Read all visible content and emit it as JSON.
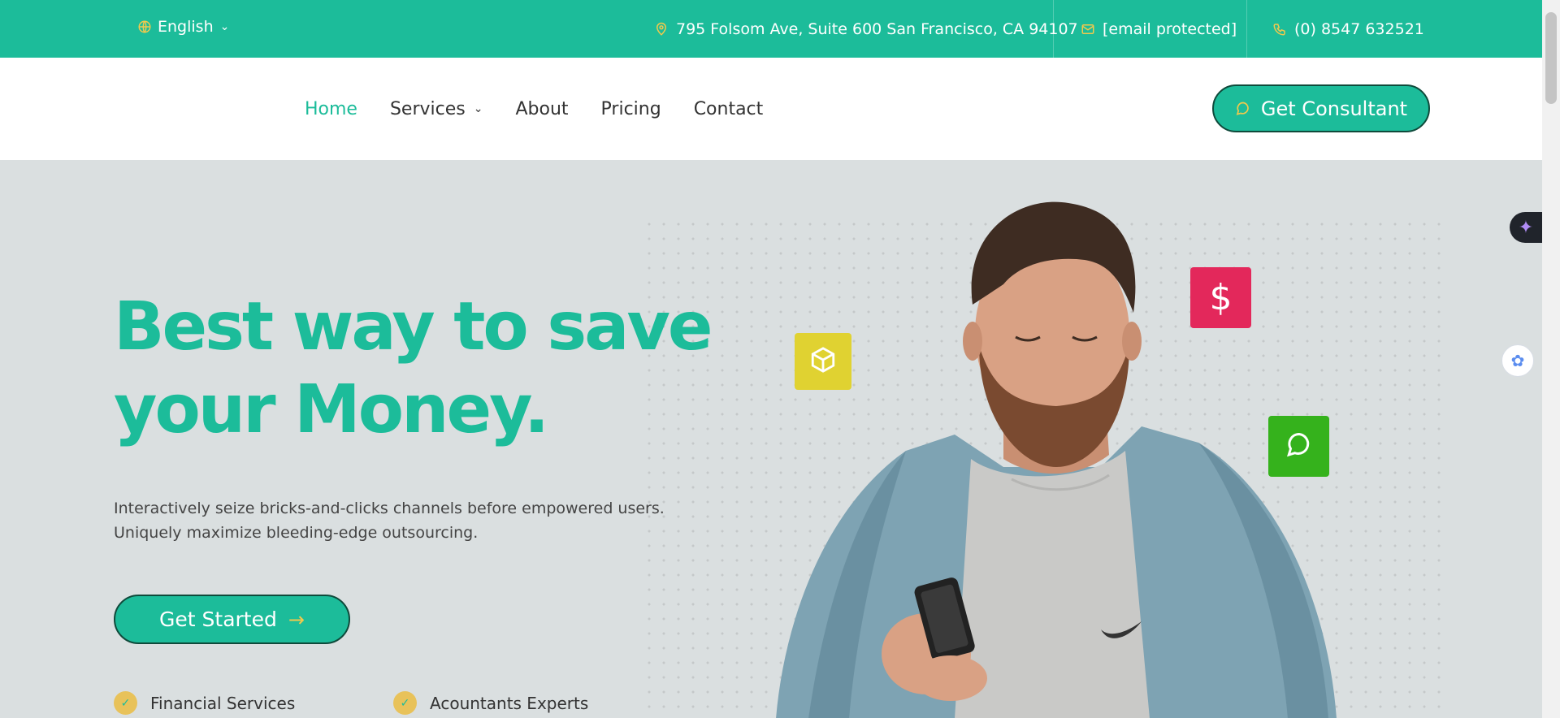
{
  "topbar": {
    "language": "English",
    "address": "795 Folsom Ave, Suite 600 San Francisco, CA 94107",
    "email": "[email protected]",
    "phone": "(0) 8547 632521"
  },
  "nav": {
    "items": [
      {
        "label": "Home",
        "active": true
      },
      {
        "label": "Services",
        "has_dropdown": true
      },
      {
        "label": "About"
      },
      {
        "label": "Pricing"
      },
      {
        "label": "Contact"
      }
    ],
    "cta_label": "Get Consultant"
  },
  "hero": {
    "headline_line1": "Best way to save",
    "headline_line2": "your Money.",
    "sub_line1": "Interactively seize bricks-and-clicks channels before empowered users.",
    "sub_line2": "Uniquely maximize bleeding-edge outsourcing.",
    "button_label": "Get Started",
    "features": [
      "Financial Services",
      "Acountants Experts"
    ],
    "tiles": [
      {
        "icon": "cube-icon",
        "color": "#e0d231"
      },
      {
        "icon": "dollar-icon",
        "color": "#e3285b",
        "glyph": "$"
      },
      {
        "icon": "chat-icon",
        "color": "#35b21c"
      }
    ]
  },
  "colors": {
    "brand": "#1cbc9a",
    "accent": "#f2c94c",
    "hero_bg": "#dadfe0"
  }
}
